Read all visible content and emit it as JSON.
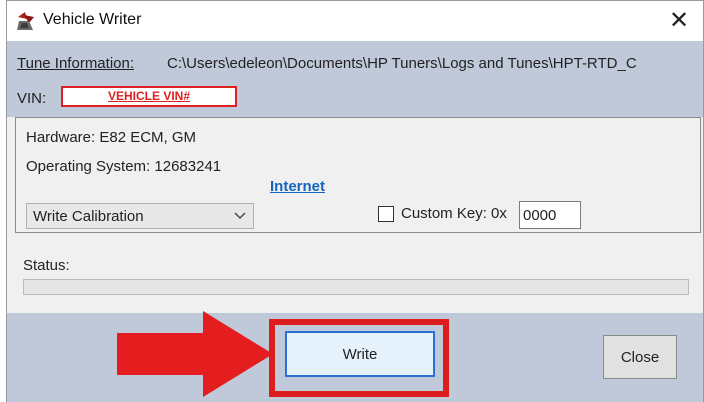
{
  "window": {
    "title": "Vehicle Writer",
    "close_glyph": "✕",
    "icon": "vehicle-writer-app-icon"
  },
  "info": {
    "tune_label": "Tune Information:",
    "tune_path": "C:\\Users\\edeleon\\Documents\\HP Tuners\\Logs and Tunes\\HPT-RTD_C",
    "vin_label": "VIN:",
    "vin_value": "VEHICLE VIN#"
  },
  "details": {
    "hardware": "Hardware: E82 ECM, GM",
    "operating_system": "Operating System: 12683241",
    "internet_link": "Internet",
    "mode_select": {
      "selected": "Write Calibration"
    },
    "custom_key": {
      "checked": false,
      "label": "Custom Key: 0x",
      "value": "0000"
    }
  },
  "status": {
    "label": "Status:",
    "progress": 0
  },
  "buttons": {
    "write": "Write",
    "close": "Close"
  },
  "colors": {
    "header_band": "#bfc9da",
    "highlight_red": "#dd1c1c",
    "link_blue": "#1565c0",
    "write_border": "#2a6fd6"
  }
}
